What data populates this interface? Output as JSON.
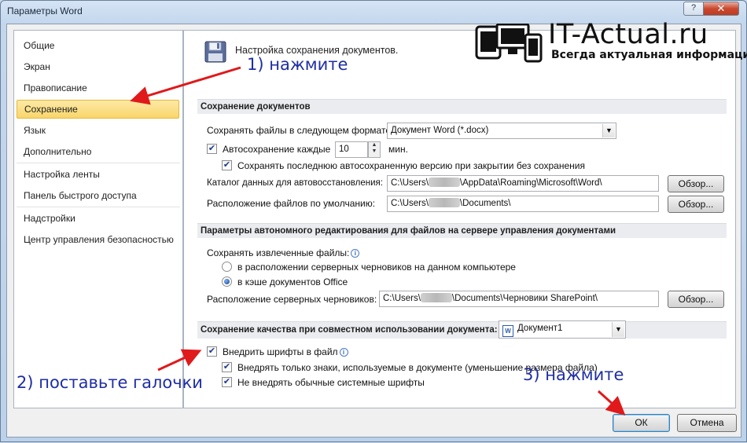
{
  "window": {
    "title": "Параметры Word",
    "help_label": "?",
    "close_label": "✕"
  },
  "sidebar": {
    "items": [
      {
        "label": "Общие"
      },
      {
        "label": "Экран"
      },
      {
        "label": "Правописание"
      },
      {
        "label": "Сохранение"
      },
      {
        "label": "Язык"
      },
      {
        "label": "Дополнительно"
      },
      {
        "label": "Настройка ленты"
      },
      {
        "label": "Панель быстрого доступа"
      },
      {
        "label": "Надстройки"
      },
      {
        "label": "Центр управления безопасностью"
      }
    ],
    "active_index": 3
  },
  "main": {
    "heading": "Настройка сохранения документов.",
    "sections": {
      "save_docs": "Сохранение документов",
      "offline": "Параметры автономного редактирования для файлов на сервере управления документами",
      "fidelity": "Сохранение качества при совместном использовании документа:"
    },
    "save_format_label": "Сохранять файлы в следующем формате:",
    "save_format_value": "Документ Word (*.docx)",
    "autosave_label": "Автосохранение каждые",
    "autosave_value": "10",
    "autosave_unit": "мин.",
    "autosave_checked": true,
    "keep_last_label": "Сохранять последнюю автосохраненную версию при закрытии без сохранения",
    "keep_last_checked": true,
    "autorecover_label": "Каталог данных для автовосстановления:",
    "autorecover_prefix": "C:\\Users\\",
    "autorecover_suffix": "\\AppData\\Roaming\\Microsoft\\Word\\",
    "default_location_label": "Расположение файлов по умолчанию:",
    "default_location_prefix": "C:\\Users\\",
    "default_location_suffix": "\\Documents\\",
    "browse_label": "Обзор...",
    "checked_out_label": "Сохранять извлеченные файлы:",
    "radio_server": "в расположении серверных черновиков на данном компьютере",
    "radio_cache": "в кэше документов Office",
    "radio_selected": "cache",
    "server_drafts_label": "Расположение серверных черновиков:",
    "server_drafts_prefix": "C:\\Users\\",
    "server_drafts_suffix": "\\Documents\\Черновики SharePoint\\",
    "fidelity_doc": "Документ1",
    "embed_fonts_label": "Внедрить шрифты в файл",
    "embed_fonts_checked": true,
    "embed_used_label": "Внедрять только знаки, используемые в документе (уменьшение размера файла)",
    "embed_used_checked": true,
    "no_common_label": "Не внедрять обычные системные шрифты",
    "no_common_checked": true
  },
  "footer": {
    "ok_label": "ОК",
    "cancel_label": "Отмена"
  },
  "annotations": {
    "step1": "1) нажмите",
    "step2": "2) поставьте галочки",
    "step3": "3) нажмите",
    "color": "#1f2ea3",
    "arrow_color": "#e0191b"
  },
  "watermark": {
    "title": "IT-Actual.ru",
    "subtitle": "Всегда актуальная информация"
  }
}
